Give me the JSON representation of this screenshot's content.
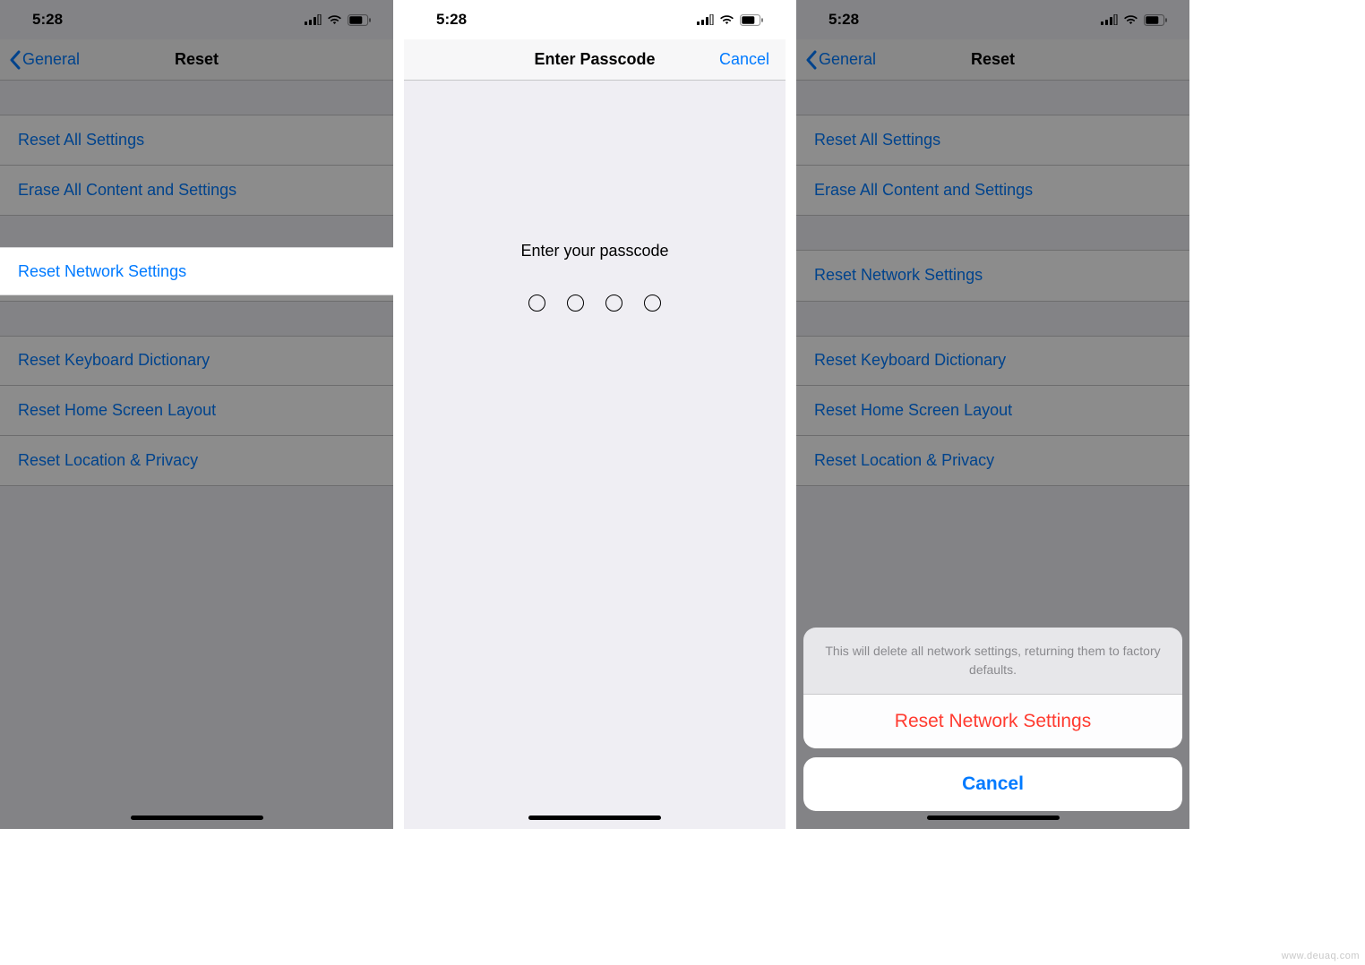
{
  "status_time": "5:28",
  "screens": {
    "left": {
      "nav_back_label": "General",
      "nav_title": "Reset",
      "rows": {
        "reset_all": "Reset All Settings",
        "erase_all": "Erase All Content and Settings",
        "reset_network": "Reset Network Settings",
        "reset_keyboard": "Reset Keyboard Dictionary",
        "reset_home": "Reset Home Screen Layout",
        "reset_location": "Reset Location & Privacy"
      }
    },
    "center": {
      "nav_title": "Enter Passcode",
      "nav_cancel": "Cancel",
      "prompt": "Enter your passcode"
    },
    "right": {
      "nav_back_label": "General",
      "nav_title": "Reset",
      "rows": {
        "reset_all": "Reset All Settings",
        "erase_all": "Erase All Content and Settings",
        "reset_network": "Reset Network Settings",
        "reset_keyboard": "Reset Keyboard Dictionary",
        "reset_home": "Reset Home Screen Layout",
        "reset_location": "Reset Location & Privacy"
      },
      "sheet": {
        "message": "This will delete all network settings, returning them to factory defaults.",
        "destructive": "Reset Network Settings",
        "cancel": "Cancel"
      }
    }
  },
  "watermark": "www.deuaq.com"
}
